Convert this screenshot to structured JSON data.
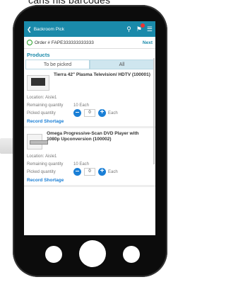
{
  "background": {
    "caption": "cans his barcodes"
  },
  "app": {
    "title": "Backroom Pick",
    "back_icon": "chevron-left-icon",
    "icons": [
      "search-icon",
      "flag-notification-icon",
      "menu-icon"
    ]
  },
  "order": {
    "label": "Order # FAPE333333333333",
    "next": "Next"
  },
  "products_heading": "Products",
  "tabs": {
    "to_be_picked": "To be picked",
    "all": "All"
  },
  "items": [
    {
      "name": "Tierra 42\" Plasma Television/ HDTV (100001)",
      "location_label": "Location:",
      "location": "Aisle1",
      "remaining_label": "Remaining quantity",
      "remaining": "10 Each",
      "picked_label": "Picked quantity",
      "picked": "0",
      "unit": "Each",
      "shortage": "Record Shortage"
    },
    {
      "name": "Omega Progressive-Scan DVD Player with 1080p Upconversion (100002)",
      "location_label": "Location:",
      "location": "Aisle1",
      "remaining_label": "Remaining quantity",
      "remaining": "10 Each",
      "picked_label": "Picked quantity",
      "picked": "0",
      "unit": "Each",
      "shortage": "Record Shortage"
    }
  ],
  "colors": {
    "header": "#1a8aaa",
    "accent": "#1a7fd6",
    "tab_inactive": "#cfe6ef"
  }
}
